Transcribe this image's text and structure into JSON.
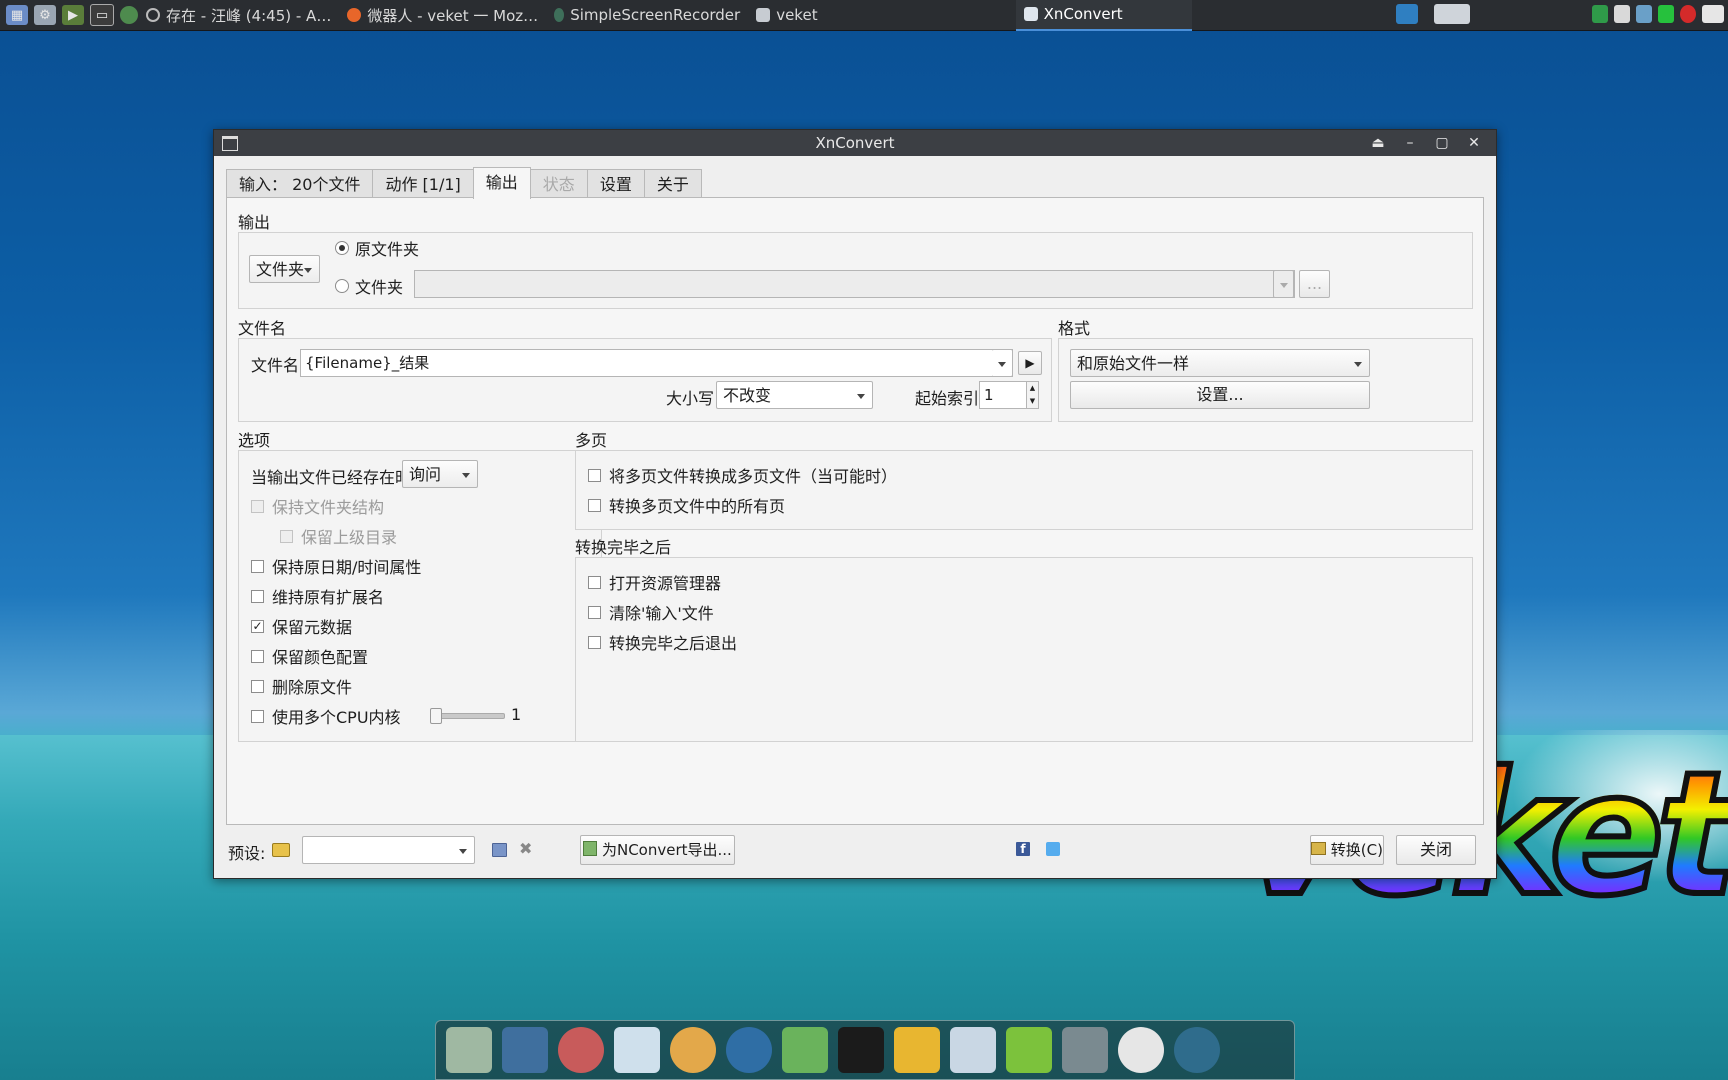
{
  "taskbar": {
    "tasks": [
      {
        "label": "存在 - 汪峰 (4:45) - A…"
      },
      {
        "label": "微器人 - veket 一 Moz…"
      },
      {
        "label": "SimpleScreenRecorder"
      },
      {
        "label": "veket"
      },
      {
        "label": "XnConvert"
      }
    ]
  },
  "window": {
    "title": "XnConvert",
    "tabs": [
      "输入： 20个文件",
      "动作 [1/1]",
      "输出",
      "状态",
      "设置",
      "关于"
    ],
    "output": {
      "group_title": "输出",
      "dest_type": "文件夹",
      "radio_original": "原文件夹",
      "radio_folder": "文件夹",
      "folder_path": "",
      "browse_label": "..."
    },
    "filename": {
      "group_title": "文件名",
      "label": "文件名",
      "value": "{Filename}_结果",
      "case_label": "大小写",
      "case_value": "不改变",
      "start_index_label": "起始索引",
      "start_index_value": "1"
    },
    "format": {
      "group_title": "格式",
      "value": "和原始文件一样",
      "settings_button": "设置..."
    },
    "options": {
      "group_title": "选项",
      "exists_label": "当输出文件已经存在时",
      "exists_value": "询问",
      "keep_structure": "保持文件夹结构",
      "keep_parent": "保留上级目录",
      "keep_date": "保持原日期/时间属性",
      "keep_ext": "维持原有扩展名",
      "keep_metadata": "保留元数据",
      "keep_color": "保留颜色配置",
      "delete_original": "删除原文件",
      "multi_cpu": "使用多个CPU内核",
      "cpu_count": "1",
      "cpu_level": 0
    },
    "multipage": {
      "group_title": "多页",
      "convert_multi": "将多页文件转换成多页文件（当可能时）",
      "convert_all": "转换多页文件中的所有页"
    },
    "after": {
      "group_title": "转换完毕之后",
      "open_explorer": "打开资源管理器",
      "clear_input": "清除'输入'文件",
      "exit_after": "转换完毕之后退出"
    },
    "bottom": {
      "preset_label": "预设:",
      "preset_value": "",
      "export_button": "为NConvert导出...",
      "convert_button": "转换(C)",
      "close_button": "关闭"
    }
  },
  "desktop": {
    "wordmark": "veket"
  }
}
